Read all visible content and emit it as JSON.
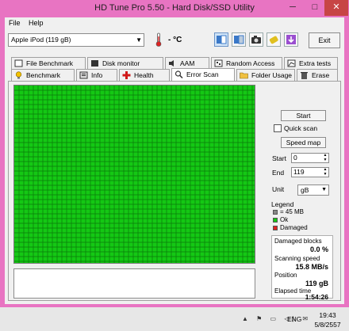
{
  "window": {
    "title": "HD Tune Pro 5.50 - Hard Disk/SSD Utility",
    "min_glyph": "─",
    "max_glyph": "□",
    "close_glyph": "✕"
  },
  "menu": {
    "file": "File",
    "help": "Help"
  },
  "toolbar": {
    "drive": "Apple  iPod (119 gB)",
    "temperature": "- °C",
    "exit_label": "Exit",
    "icons": [
      "copy-info-icon",
      "copy-screenshot-icon",
      "camera-icon",
      "options-icon",
      "download-icon"
    ]
  },
  "tabs": {
    "row1": [
      "File Benchmark",
      "Disk monitor",
      "AAM",
      "Random Access",
      "Extra tests"
    ],
    "row2": [
      "Benchmark",
      "Info",
      "Health",
      "Error Scan",
      "Folder Usage",
      "Erase"
    ],
    "active": "Error Scan"
  },
  "scan": {
    "grid_color": "#14c814",
    "grid_line_color": "#0a7a0a",
    "start_label": "Start",
    "quick_scan_label": "Quick scan",
    "quick_scan_checked": false,
    "speed_map_label": "Speed map",
    "start_field_label": "Start",
    "start_value": "0",
    "end_field_label": "End",
    "end_value": "119",
    "unit_label": "Unit",
    "unit_value": "gB"
  },
  "legend": {
    "title": "Legend",
    "items": [
      {
        "label": "= 45 MB",
        "color": "#888888"
      },
      {
        "label": "Ok",
        "color": "#14c814"
      },
      {
        "label": "Damaged",
        "color": "#e02020"
      }
    ]
  },
  "stats": {
    "damaged_label": "Damaged blocks",
    "damaged_value": "0.0 %",
    "speed_label": "Scanning speed",
    "speed_value": "15.8 MB/s",
    "position_label": "Position",
    "position_value": "119 gB",
    "elapsed_label": "Elapsed time",
    "elapsed_value": "1:54:26"
  },
  "taskbar": {
    "tray": "▲ ⚑ ▭ ◁) ✉",
    "lang": "ENG",
    "time": "19:43",
    "date": "5/8/2557"
  }
}
